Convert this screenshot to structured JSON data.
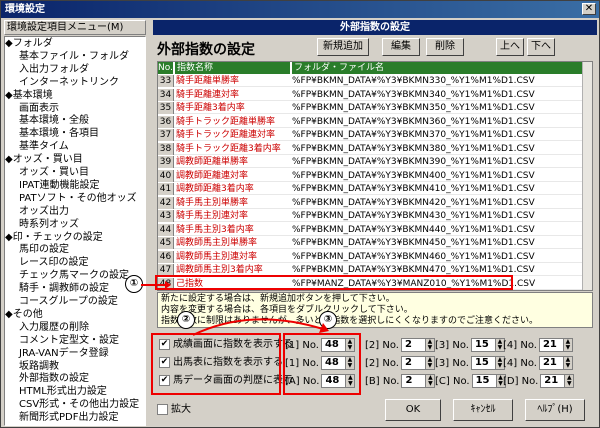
{
  "window_title": "環境設定",
  "menu_label": "環境設定項目メニュー(M)",
  "tree": [
    {
      "label": "◆フォルダ",
      "level": 0
    },
    {
      "label": "基本ファイル・フォルダ",
      "level": 1
    },
    {
      "label": "入出力フォルダ",
      "level": 1
    },
    {
      "label": "インターネットリンク",
      "level": 1
    },
    {
      "label": "◆基本環境",
      "level": 0
    },
    {
      "label": "画面表示",
      "level": 1
    },
    {
      "label": "基本環境・全般",
      "level": 1
    },
    {
      "label": "基本環境・各項目",
      "level": 1
    },
    {
      "label": "基準タイム",
      "level": 1
    },
    {
      "label": "◆オッズ・買い目",
      "level": 0
    },
    {
      "label": "オッズ・買い目",
      "level": 1
    },
    {
      "label": "IPAT連動機能設定",
      "level": 1
    },
    {
      "label": "PATソフト・その他オッズ",
      "level": 1
    },
    {
      "label": "オッズ出力",
      "level": 1
    },
    {
      "label": "時系列オッズ",
      "level": 1
    },
    {
      "label": "◆印・チェックの設定",
      "level": 0
    },
    {
      "label": "馬印の設定",
      "level": 1
    },
    {
      "label": "レース印の設定",
      "level": 1
    },
    {
      "label": "チェック馬マークの設定",
      "level": 1
    },
    {
      "label": "騎手・調教師の設定",
      "level": 1
    },
    {
      "label": "コースグループの設定",
      "level": 1
    },
    {
      "label": "◆その他",
      "level": 0
    },
    {
      "label": "入力履歴の削除",
      "level": 1
    },
    {
      "label": "コメント定型文・設定",
      "level": 1
    },
    {
      "label": "JRA-VANデータ登録",
      "level": 1
    },
    {
      "label": "坂路調教",
      "level": 1
    },
    {
      "label": "外部指数の設定",
      "level": 1
    },
    {
      "label": "HTML形式出力設定",
      "level": 1
    },
    {
      "label": "CSV形式・その他出力設定",
      "level": 1
    },
    {
      "label": "新聞形式PDF出力設定",
      "level": 1
    }
  ],
  "panel_title": "外部指数の設定",
  "heading": "外部指数の設定",
  "buttons": {
    "add": "新規追加",
    "edit": "編集",
    "delete": "削除",
    "up": "上へ",
    "down": "下へ",
    "ok": "OK",
    "cancel": "ｷｬﾝｾﾙ",
    "help": "ﾍﾙﾌﾟ(H)"
  },
  "grid_headers": {
    "no": "No.",
    "name": "指数名称",
    "path": "フォルダ・ファイル名"
  },
  "rows": [
    {
      "no": "33",
      "name": "騎手距離単勝率",
      "path": "%FP¥BKMN_DATA¥%Y3¥BKMN330_%Y1%M1%D1.CSV"
    },
    {
      "no": "34",
      "name": "騎手距離連対率",
      "path": "%FP¥BKMN_DATA¥%Y3¥BKMN340_%Y1%M1%D1.CSV"
    },
    {
      "no": "35",
      "name": "騎手距離3着内率",
      "path": "%FP¥BKMN_DATA¥%Y3¥BKMN350_%Y1%M1%D1.CSV"
    },
    {
      "no": "36",
      "name": "騎手トラック距離単勝率",
      "path": "%FP¥BKMN_DATA¥%Y3¥BKMN360_%Y1%M1%D1.CSV"
    },
    {
      "no": "37",
      "name": "騎手トラック距離連対率",
      "path": "%FP¥BKMN_DATA¥%Y3¥BKMN370_%Y1%M1%D1.CSV"
    },
    {
      "no": "38",
      "name": "騎手トラック距離3着内率",
      "path": "%FP¥BKMN_DATA¥%Y3¥BKMN380_%Y1%M1%D1.CSV"
    },
    {
      "no": "39",
      "name": "調教師距離単勝率",
      "path": "%FP¥BKMN_DATA¥%Y3¥BKMN390_%Y1%M1%D1.CSV"
    },
    {
      "no": "40",
      "name": "調教師距離連対率",
      "path": "%FP¥BKMN_DATA¥%Y3¥BKMN400_%Y1%M1%D1.CSV"
    },
    {
      "no": "41",
      "name": "調教師距離3着内率",
      "path": "%FP¥BKMN_DATA¥%Y3¥BKMN410_%Y1%M1%D1.CSV"
    },
    {
      "no": "42",
      "name": "騎手馬主別単勝率",
      "path": "%FP¥BKMN_DATA¥%Y3¥BKMN420_%Y1%M1%D1.CSV"
    },
    {
      "no": "43",
      "name": "騎手馬主別連対率",
      "path": "%FP¥BKMN_DATA¥%Y3¥BKMN430_%Y1%M1%D1.CSV"
    },
    {
      "no": "44",
      "name": "騎手馬主別3着内率",
      "path": "%FP¥BKMN_DATA¥%Y3¥BKMN440_%Y1%M1%D1.CSV"
    },
    {
      "no": "45",
      "name": "調教師馬主別単勝率",
      "path": "%FP¥BKMN_DATA¥%Y3¥BKMN450_%Y1%M1%D1.CSV"
    },
    {
      "no": "46",
      "name": "調教師馬主別連対率",
      "path": "%FP¥BKMN_DATA¥%Y3¥BKMN460_%Y1%M1%D1.CSV"
    },
    {
      "no": "47",
      "name": "調教師馬主別3着内率",
      "path": "%FP¥BKMN_DATA¥%Y3¥BKMN470_%Y1%M1%D1.CSV"
    },
    {
      "no": "48",
      "name": "己指数",
      "path": "%FP¥MANZ_DATA¥%Y3¥MANZ010_%Y1%M1%D1.CSV"
    }
  ],
  "info_text": "新たに設定する場合は、新規追加ボタンを押して下さい。\n内容を変更する場合は、各項目をダブルクリックして下さい。\n指数の数に制限はありませんが、多いと、指数を選択しにくくなりますのでご注意ください。",
  "checks": [
    {
      "label": "成績画面に指数を表示する",
      "checked": true
    },
    {
      "label": "出馬表に指数を表示する",
      "checked": true
    },
    {
      "label": "馬データ画面の判歴に表示",
      "checked": true
    }
  ],
  "spin_rows": [
    [
      {
        "label": "[1] No.",
        "value": "48"
      },
      {
        "label": "[2] No.",
        "value": "2"
      },
      {
        "label": "[3] No.",
        "value": "15"
      },
      {
        "label": "[4] No.",
        "value": "21"
      }
    ],
    [
      {
        "label": "[1] No.",
        "value": "48"
      },
      {
        "label": "[2] No.",
        "value": "2"
      },
      {
        "label": "[3] No.",
        "value": "15"
      },
      {
        "label": "[4] No.",
        "value": "21"
      }
    ],
    [
      {
        "label": "[A] No.",
        "value": "48"
      },
      {
        "label": "[B] No.",
        "value": "2"
      },
      {
        "label": "[C] No.",
        "value": "15"
      },
      {
        "label": "[D] No.",
        "value": "21"
      }
    ]
  ],
  "expand_label": "拡大",
  "callouts": [
    "①",
    "②",
    "③"
  ]
}
